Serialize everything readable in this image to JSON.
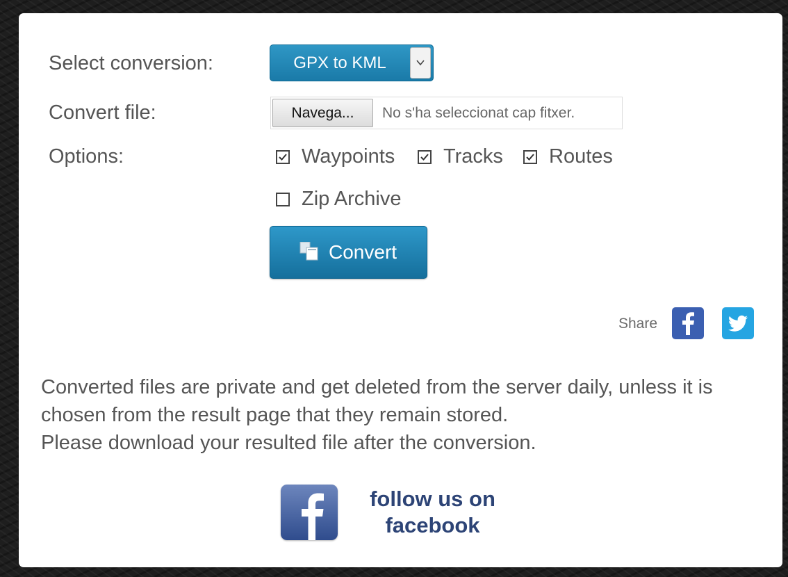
{
  "form": {
    "select_label": "Select conversion:",
    "select_value": "GPX to KML",
    "file_label": "Convert file:",
    "file_button": "Navega...",
    "file_status": "No s'ha seleccionat cap fitxer.",
    "options_label": "Options:",
    "options": [
      {
        "label": "Waypoints",
        "checked": true
      },
      {
        "label": "Tracks",
        "checked": true
      },
      {
        "label": "Routes",
        "checked": true
      },
      {
        "label": "Zip Archive",
        "checked": false
      }
    ],
    "convert_button": "Convert"
  },
  "share": {
    "label": "Share",
    "icons": [
      "facebook-icon",
      "twitter-icon"
    ]
  },
  "info": {
    "line1": "Converted files are private and get deleted from the server daily, unless it is chosen from the result page that they remain stored.",
    "line2": "Please download your resulted file after the conversion."
  },
  "follow": {
    "line1": "follow us on",
    "line2": "facebook"
  },
  "colors": {
    "accent": "#1f84b4",
    "facebook": "#3b5fb1",
    "twitter": "#25a5e2",
    "follow_text": "#2d4476"
  }
}
